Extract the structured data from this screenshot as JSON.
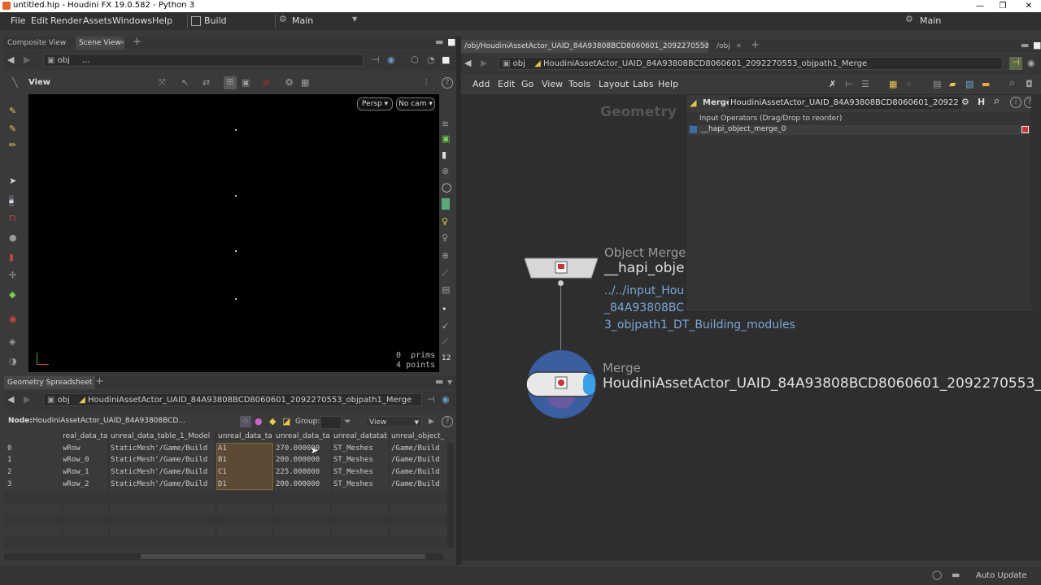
{
  "window": {
    "title": "untitled.hip - Houdini FX 19.0.582 - Python 3"
  },
  "menu": {
    "items": [
      "File",
      "Edit",
      "Render",
      "Assets",
      "Windows",
      "Help"
    ],
    "desktop": "Build",
    "context": "Main",
    "right_desktop": "Main"
  },
  "left_tabs": {
    "tab1": "Composite View",
    "tab2": "Scene View"
  },
  "left_path": {
    "root": "obj",
    "sub": "..."
  },
  "viewer": {
    "label": "View",
    "persp": "Persp",
    "cam": "No cam",
    "prims_count": "0",
    "prims_label": "prims",
    "points_count": "4",
    "points_label": "points"
  },
  "spreadsheet": {
    "tab": "Geometry Spreadsheet",
    "path_root": "obj",
    "path_node": "HoudiniAssetActor_UAID_84A93808BCD8060601_2092270553_objpath1_Merge",
    "node_label": "Node:",
    "node_name": "HoudiniAssetActor_UAID_84A93808BCD...",
    "group_label": "Group:",
    "view_label": "View",
    "columns": [
      "real_data_ta",
      "unreal_data_table_1_Model",
      "unreal_data_ta",
      "unreal_data_ta",
      "unreal_datatabl",
      "unreal_object_"
    ],
    "rows": [
      {
        "idx": "0",
        "c1": "wRow",
        "c2": "StaticMesh'/Game/Build",
        "c3": "A1",
        "c4": "270.000000",
        "c5": "ST_Meshes",
        "c6": "/Game/Build"
      },
      {
        "idx": "1",
        "c1": "wRow_0",
        "c2": "StaticMesh'/Game/Build",
        "c3": "B1",
        "c4": "200.000000",
        "c5": "ST_Meshes",
        "c6": "/Game/Build"
      },
      {
        "idx": "2",
        "c1": "wRow_1",
        "c2": "StaticMesh'/Game/Build",
        "c3": "C1",
        "c4": "225.000000",
        "c5": "ST_Meshes",
        "c6": "/Game/Build"
      },
      {
        "idx": "3",
        "c1": "wRow_2",
        "c2": "StaticMesh'/Game/Build",
        "c3": "D1",
        "c4": "200.000000",
        "c5": "ST_Meshes",
        "c6": "/Game/Build"
      }
    ]
  },
  "right_tabs": {
    "tab1": "/obj/HoudiniAssetActor_UAID_84A93808BCD8060601_2092270553_objp...",
    "tab2": "/obj"
  },
  "right_path": {
    "root": "obj",
    "node": "HoudiniAssetActor_UAID_84A93808BCD8060601_2092270553_objpath1_Merge"
  },
  "net_menu": [
    "Add",
    "Edit",
    "Go",
    "View",
    "Tools",
    "Layout",
    "Labs",
    "Help"
  ],
  "network": {
    "context_label": "Geometry",
    "node1_type": "Object Merge",
    "node1_name": "__hapi_obje",
    "node1_path_1": "../../input_Hou",
    "node1_path_2": "_84A93808BC",
    "node1_path_3": "3_objpath1_DT_Building_modules",
    "node2_type": "Merge",
    "node2_name": "HoudiniAssetActor_UAID_84A93808BCD8060601_2092270553_objpa"
  },
  "params": {
    "type": "Merge",
    "name": "HoudiniAssetActor_UAID_84A93808BCD8060601_20922",
    "section": "Input Operators (Drag/Drop to reorder)",
    "input0": "__hapi_object_merge_0"
  },
  "status": {
    "auto_update": "Auto Update"
  }
}
